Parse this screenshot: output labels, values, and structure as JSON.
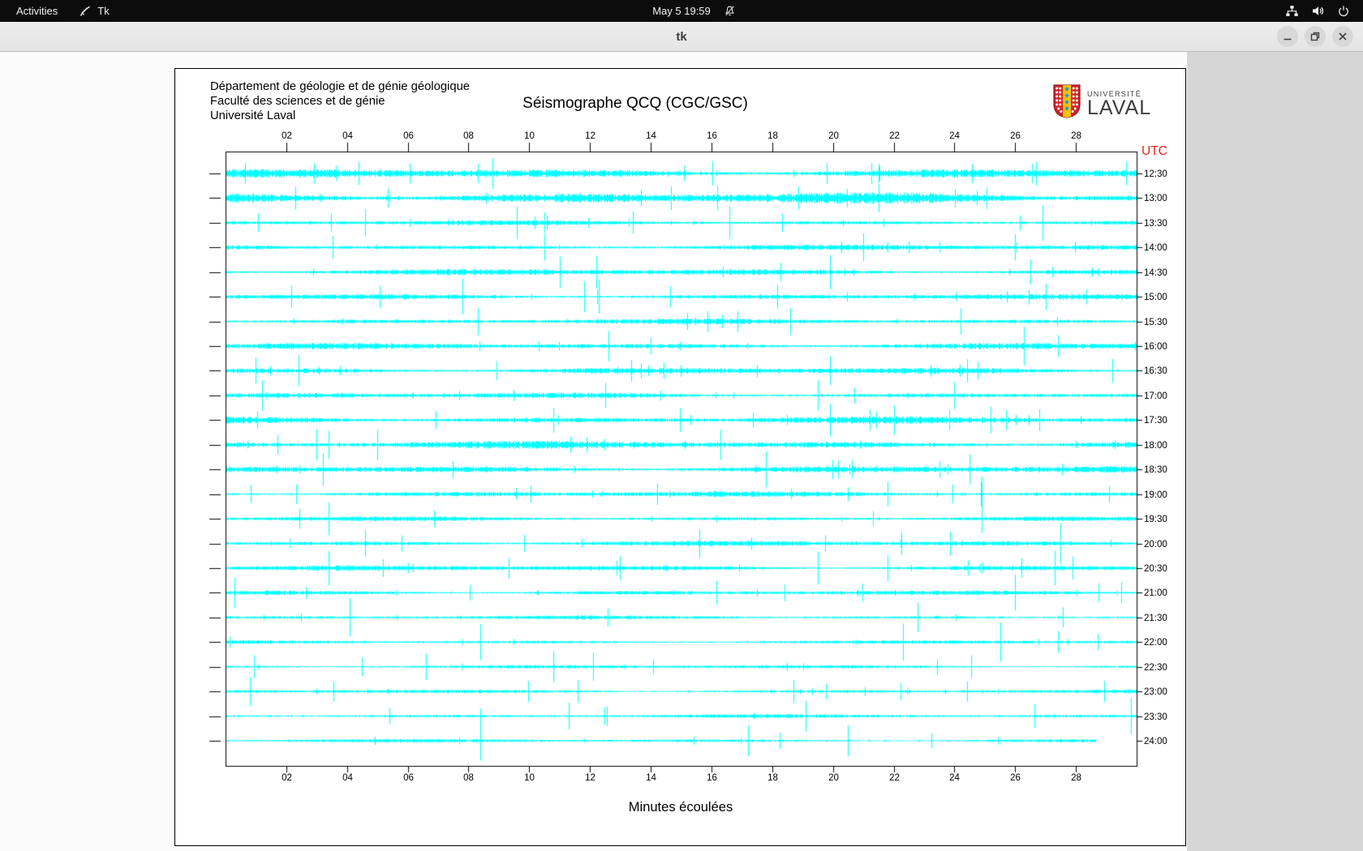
{
  "topbar": {
    "activities_label": "Activities",
    "app_menu_label": "Tk",
    "clock_text": "May 5 19:59",
    "icons": [
      "tk-feather-icon",
      "bell-slash-icon",
      "network-wired-icon",
      "volume-icon",
      "power-icon"
    ]
  },
  "window": {
    "title": "tk",
    "control_icons": [
      "minimize-icon",
      "restore-icon",
      "close-icon"
    ]
  },
  "seismograph": {
    "institution_lines": [
      "Département de géologie et de génie géologique",
      "Faculté des sciences et de génie",
      "Université Laval"
    ],
    "plot_title": "Séismographe QCQ (CGC/GSC)",
    "logo": {
      "top": "UNIVERSITÉ",
      "bottom": "LAVAL"
    },
    "utc_label": "UTC",
    "xlabel": "Minutes écoulées",
    "x_tick_labels": [
      "02",
      "04",
      "06",
      "08",
      "10",
      "12",
      "14",
      "16",
      "18",
      "20",
      "22",
      "24",
      "26",
      "28"
    ],
    "x_range_minutes": [
      0,
      30
    ],
    "colors": {
      "trace": "#00ffff",
      "frame": "#000000",
      "utc_text": "#f32017",
      "logo_red": "#d2232a",
      "logo_gold": "#f2c400",
      "logo_blue": "#2a9ad4",
      "logo_text": "#3d3d3d"
    },
    "rows": [
      {
        "time": "12:30",
        "amp": 5.0,
        "spike_minutes": [
          8.8,
          19.8
        ]
      },
      {
        "time": "13:00",
        "amp": 6.0,
        "spike_minutes": [
          16.2,
          21.5
        ]
      },
      {
        "time": "13:30",
        "amp": 2.6,
        "spike_minutes": [
          4.6,
          9.6,
          16.6,
          26.9
        ]
      },
      {
        "time": "14:00",
        "amp": 3.0,
        "spike_minutes": [
          10.5,
          21.0,
          26.0
        ]
      },
      {
        "time": "14:30",
        "amp": 3.4,
        "spike_minutes": [
          11.0,
          12.2,
          19.9,
          26.5
        ]
      },
      {
        "time": "15:00",
        "amp": 3.0,
        "spike_minutes": [
          7.8,
          11.8,
          12.3,
          27.0
        ]
      },
      {
        "time": "15:30",
        "amp": 3.0,
        "spike_minutes": [
          8.3,
          18.6,
          24.2
        ]
      },
      {
        "time": "16:00",
        "amp": 3.4,
        "spike_minutes": [
          12.6,
          26.3
        ]
      },
      {
        "time": "16:30",
        "amp": 3.4,
        "spike_minutes": [
          1.0,
          2.4,
          19.9
        ]
      },
      {
        "time": "17:00",
        "amp": 3.0,
        "spike_minutes": [
          1.2,
          12.5,
          19.5,
          24.0
        ]
      },
      {
        "time": "17:30",
        "amp": 3.8,
        "spike_minutes": [
          10.8,
          19.9,
          22.0,
          25.2
        ]
      },
      {
        "time": "18:00",
        "amp": 4.2,
        "spike_minutes": [
          3.0,
          3.4,
          5.0,
          16.3
        ]
      },
      {
        "time": "18:30",
        "amp": 3.8,
        "spike_minutes": [
          3.2,
          17.8,
          24.5
        ]
      },
      {
        "time": "19:00",
        "amp": 3.0,
        "spike_minutes": [
          14.2,
          21.8,
          24.9
        ]
      },
      {
        "time": "19:30",
        "amp": 2.5,
        "spike_minutes": [
          3.4,
          24.9
        ]
      },
      {
        "time": "20:00",
        "amp": 3.0,
        "spike_minutes": [
          4.6,
          15.6,
          27.5
        ]
      },
      {
        "time": "20:30",
        "amp": 3.0,
        "spike_minutes": [
          3.4,
          19.5,
          21.8,
          27.3
        ]
      },
      {
        "time": "21:00",
        "amp": 2.5,
        "spike_minutes": [
          0.3,
          26.0
        ]
      },
      {
        "time": "21:30",
        "amp": 2.0,
        "spike_minutes": [
          4.1,
          22.8
        ]
      },
      {
        "time": "22:00",
        "amp": 2.0,
        "spike_minutes": [
          8.4,
          22.3,
          25.5
        ]
      },
      {
        "time": "22:30",
        "amp": 2.0,
        "spike_minutes": [
          6.6,
          10.8,
          12.1
        ]
      },
      {
        "time": "23:00",
        "amp": 2.0,
        "spike_minutes": [
          0.8,
          11.6,
          18.7
        ]
      },
      {
        "time": "23:30",
        "amp": 2.0,
        "spike_minutes": [
          11.3,
          19.1,
          29.8
        ]
      },
      {
        "time": "24:00",
        "amp": 1.8,
        "spike_minutes": [
          8.4,
          17.2,
          20.5
        ],
        "end_fraction": 0.955
      }
    ]
  },
  "chart_data": {
    "type": "line",
    "variant": "helicorder_seismograph",
    "title": "Séismographe QCQ (CGC/GSC)",
    "xlabel": "Minutes écoulées",
    "x_ticks": [
      2,
      4,
      6,
      8,
      10,
      12,
      14,
      16,
      18,
      20,
      22,
      24,
      26,
      28
    ],
    "x_range": [
      0,
      30
    ],
    "y_axis_unit": "UTC",
    "minutes_per_trace": 30,
    "trace_start_times_utc": [
      "12:30",
      "13:00",
      "13:30",
      "14:00",
      "14:30",
      "15:00",
      "15:30",
      "16:00",
      "16:30",
      "17:00",
      "17:30",
      "18:00",
      "18:30",
      "19:00",
      "19:30",
      "20:00",
      "20:30",
      "21:00",
      "21:30",
      "22:00",
      "22:30",
      "23:00",
      "23:30",
      "24:00"
    ],
    "note": "24 half-hour traces of continuous microseismic noise with sporadic spikes; amplitudes unlabeled; last trace (24:00) partial, ending near 28.7 minutes"
  }
}
